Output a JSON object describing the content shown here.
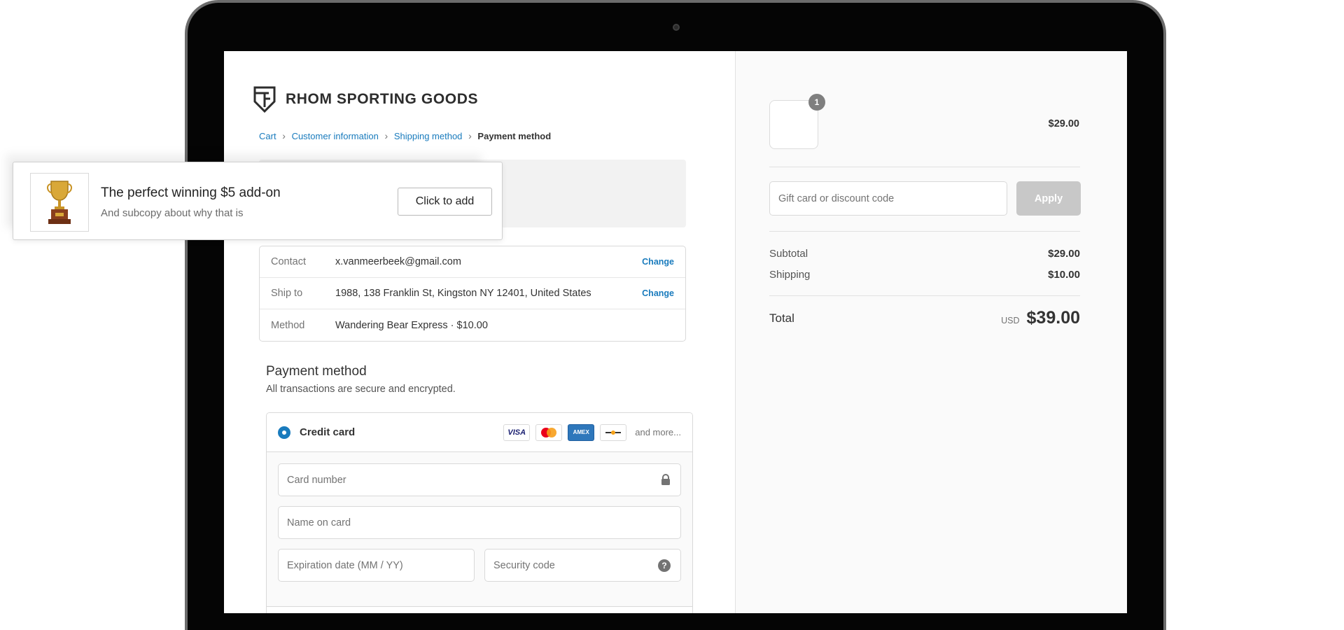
{
  "store": {
    "name": "RHOM SPORTING GOODS",
    "logo_icon": "rhom-logo-icon"
  },
  "breadcrumb": [
    {
      "label": "Cart"
    },
    {
      "label": "Customer information"
    },
    {
      "label": "Shipping method"
    },
    {
      "label": "Payment method"
    }
  ],
  "review": {
    "contact": {
      "label": "Contact",
      "value": "x.vanmeerbeek@gmail.com",
      "action": "Change"
    },
    "ship_to": {
      "label": "Ship to",
      "value": "1988, 138 Franklin St, Kingston NY 12401, United States",
      "action": "Change"
    },
    "method": {
      "label": "Method",
      "value": "Wandering Bear Express · $10.00"
    }
  },
  "payment": {
    "title": "Payment method",
    "subtitle": "All transactions are secure and encrypted.",
    "option_label": "Credit card",
    "card_brands": [
      "VISA",
      "mastercard-icon",
      "AMEX",
      "discover-icon"
    ],
    "visa_text": "VISA",
    "amex_text": "AMEX",
    "and_more": "and more...",
    "fields": {
      "card_number": "Card number",
      "name_on_card": "Name on card",
      "expiration": "Expiration date (MM / YY)",
      "security_code": "Security code"
    }
  },
  "summary": {
    "quantity": "1",
    "line_price": "$29.00",
    "discount_placeholder": "Gift card or discount code",
    "apply_label": "Apply",
    "subtotal_label": "Subtotal",
    "subtotal_value": "$29.00",
    "shipping_label": "Shipping",
    "shipping_value": "$10.00",
    "total_label": "Total",
    "currency": "USD",
    "total_value": "$39.00"
  },
  "upsell": {
    "title": "The perfect winning $5 add-on",
    "subtitle": "And subcopy about why that is",
    "button_label": "Click to add",
    "image_icon": "trophy-icon"
  },
  "colors": {
    "link": "#197bbd",
    "apply_disabled": "#c8c8c8",
    "badge": "#7f7f7f"
  }
}
